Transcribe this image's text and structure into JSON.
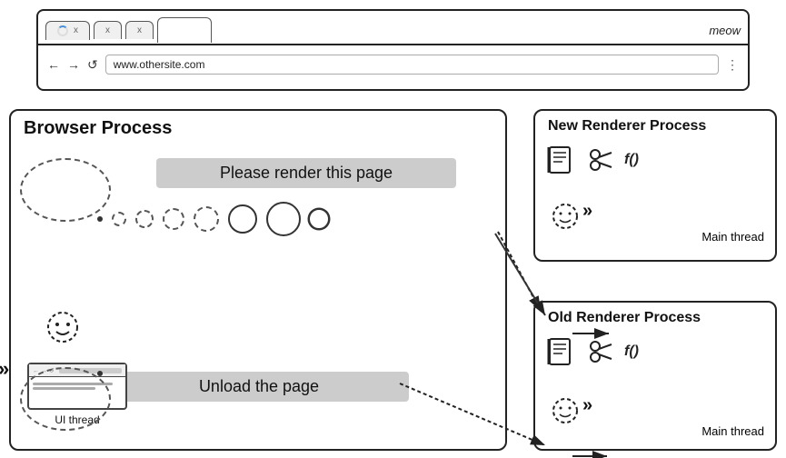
{
  "browser": {
    "tabs": [
      {
        "label": "",
        "loading": true,
        "close": "x"
      },
      {
        "label": "",
        "loading": false,
        "close": "x"
      },
      {
        "label": "",
        "loading": false,
        "close": "x"
      }
    ],
    "brand_label": "meow",
    "url": "www.othersite.com",
    "nav_back": "←",
    "nav_forward": "→",
    "nav_reload": "↺",
    "nav_more": "⋮"
  },
  "diagram": {
    "browser_process_title": "Browser Process",
    "new_renderer_title": "New Renderer Process",
    "old_renderer_title": "Old Renderer Process",
    "render_message": "Please render this page",
    "unload_message": "Unload the page",
    "ui_thread_label": "UI thread",
    "main_thread_label": "Main thread",
    "main_thread_label2": "Main thread"
  }
}
